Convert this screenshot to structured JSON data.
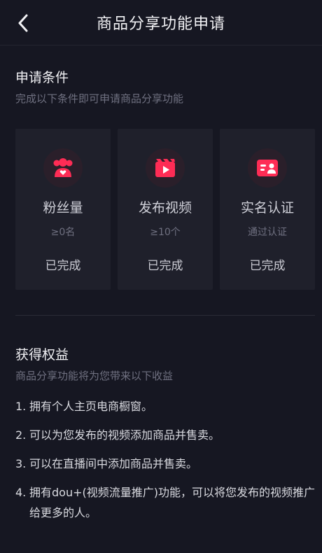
{
  "header": {
    "title": "商品分享功能申请"
  },
  "conditions": {
    "title": "申请条件",
    "subtitle": "完成以下条件即可申请商品分享功能",
    "cards": [
      {
        "icon": "fans-icon",
        "label": "粉丝量",
        "requirement": "≥0名",
        "status": "已完成"
      },
      {
        "icon": "video-icon",
        "label": "发布视频",
        "requirement": "≥10个",
        "status": "已完成"
      },
      {
        "icon": "id-card-icon",
        "label": "实名认证",
        "requirement": "通过认证",
        "status": "已完成"
      }
    ]
  },
  "benefits": {
    "title": "获得权益",
    "subtitle": "商品分享功能将为您带来以下收益",
    "items": [
      {
        "num": "1.",
        "text": "拥有个人主页电商橱窗。"
      },
      {
        "num": "2.",
        "text": "可以为您发布的视频添加商品并售卖。"
      },
      {
        "num": "3.",
        "text": "可以在直播间中添加商品并售卖。"
      },
      {
        "num": "4.",
        "text": "拥有dou+(视频流量推广)功能，可以将您发布的视频推广给更多的人。"
      }
    ]
  },
  "colors": {
    "background": "#161722",
    "card": "#1f202b",
    "accent": "#fe2c55"
  }
}
